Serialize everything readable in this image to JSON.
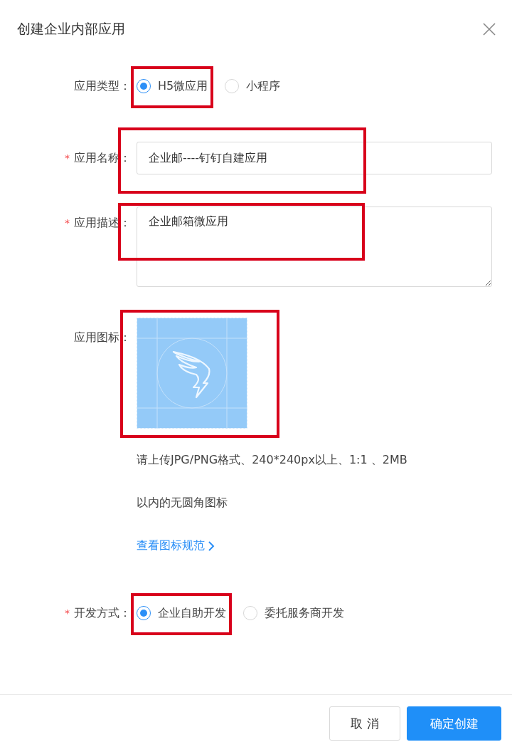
{
  "dialog": {
    "title": "创建企业内部应用",
    "fields": [
      {
        "kind": "radio",
        "label": "应用类型：",
        "options": [
          {
            "label": "H5微应用",
            "selected": true,
            "highlighted": true
          },
          {
            "label": "小程序",
            "selected": false,
            "highlighted": false
          }
        ]
      },
      {
        "kind": "input",
        "required_mark": "*",
        "label": "应用名称：",
        "value": "企业邮----钉钉自建应用",
        "highlighted": true
      },
      {
        "kind": "textarea",
        "required_mark": "*",
        "label": "应用描述：",
        "value": "企业邮箱微应用",
        "highlighted": true
      },
      {
        "kind": "icon_upload",
        "label": "应用图标：",
        "highlighted": true,
        "hint": [
          "请上传JPG/PNG格式、240*240px以上、1:1 、2MB",
          "以内的无圆角图标"
        ],
        "link": "查看图标规范"
      },
      {
        "kind": "radio",
        "required_mark": "*",
        "label": "开发方式：",
        "options": [
          {
            "label": "企业自助开发",
            "selected": true,
            "highlighted": true
          },
          {
            "label": "委托服务商开发",
            "selected": false,
            "highlighted": false
          }
        ]
      }
    ],
    "buttons": [
      {
        "label": "取 消",
        "kind": "default"
      },
      {
        "label": "确定创建",
        "kind": "primary"
      }
    ]
  }
}
